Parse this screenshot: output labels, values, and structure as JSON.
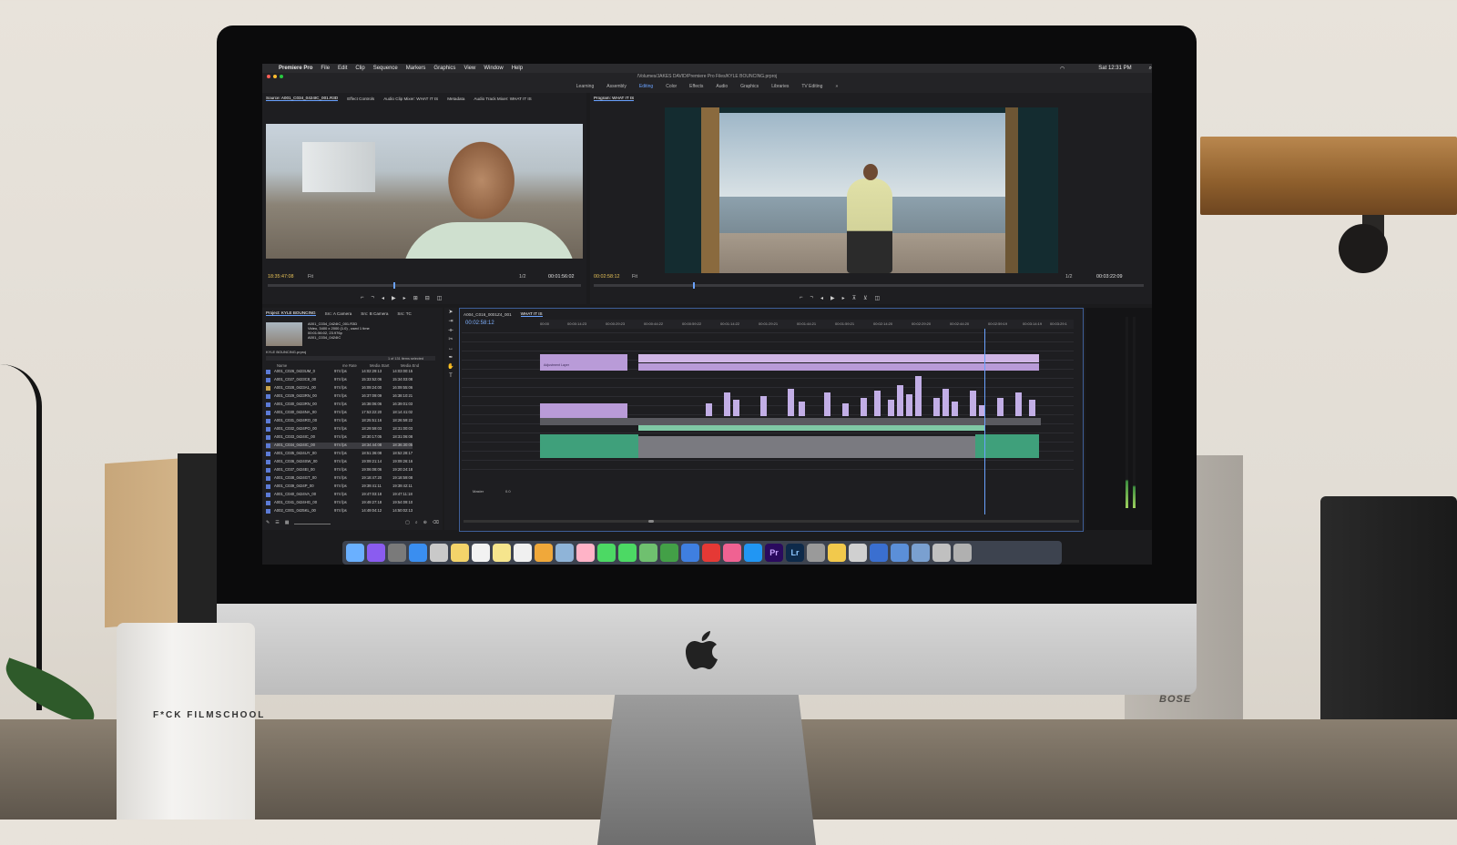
{
  "menubar": {
    "app": "Premiere Pro",
    "items": [
      "File",
      "Edit",
      "Clip",
      "Sequence",
      "Markers",
      "Graphics",
      "View",
      "Window",
      "Help"
    ],
    "clock": "Sat 12:31 PM"
  },
  "titlebar": {
    "path": "/Volumes/JAKES DAVID/Premiere Pro Files/KYLE BOUNCING.prproj"
  },
  "workspaces": {
    "items": [
      "Learning",
      "Assembly",
      "Editing",
      "Color",
      "Effects",
      "Audio",
      "Graphics",
      "Libraries",
      "TV Editing"
    ],
    "active": "Editing"
  },
  "source_panel": {
    "tabs": [
      "Source: A001_C034_0424IC_001.R3D",
      "Effect Controls",
      "Audio Clip Mixer: WHAT IT IS",
      "Metadata",
      "Audio Track Mixer: WHAT IT IS"
    ],
    "timecode": "18:35:47:08",
    "zoom": "Fit",
    "fraction": "1/2",
    "duration": "00:01:56:02"
  },
  "program_panel": {
    "tab": "Program: WHAT IT IS",
    "timecode": "00:02:58:12",
    "zoom": "Fit",
    "fraction": "1/2",
    "duration": "00:03:22:09"
  },
  "project_panel": {
    "tabs": [
      "Project: KYLE BOUNCING",
      "Src: A Camera",
      "Src: B Camera",
      "Src: TC"
    ],
    "preview_name": "A001_C034_0424IC_001.R3D",
    "preview_info": "Video, 3400 x 2000 (1.0)",
    "preview_uses": "used 1 time",
    "preview_tc": "00:01:56:02, 23.976p",
    "preview_audio": "A001_C034_0424IC",
    "bin": "KYLE BOUNCING.prproj",
    "selected_count": "1 of 131 items selected",
    "columns": [
      "Name",
      "me Rate",
      "Media Start",
      "Media End"
    ],
    "rows": [
      [
        "A001_C026_0423UM_0",
        "974 fps",
        "14:02:29:13",
        "14:03:00:15"
      ],
      [
        "A001_C027_0423C8_00",
        "974 fps",
        "15:33:52:06",
        "15:34:03:08"
      ],
      [
        "A001_C028_0423A1_00",
        "974 fps",
        "16:09:24:00",
        "16:09:55:06"
      ],
      [
        "A001_C029_0423RN_00",
        "974 fps",
        "16:37:09:09",
        "16:38:10:21"
      ],
      [
        "A001_C030_0423RN_00",
        "974 fps",
        "16:38:06:06",
        "16:39:01:03"
      ],
      [
        "A001_C030_0424NA_00",
        "974 fps",
        "17:53:22:20",
        "18:14:41:02"
      ],
      [
        "A001_C031_0424RO_00",
        "974 fps",
        "18:25:51:16",
        "18:26:59:22"
      ],
      [
        "A001_C032_0424PO_00",
        "974 fps",
        "18:29:59:03",
        "18:31:00:03"
      ],
      [
        "A001_C033_0424IC_00",
        "974 fps",
        "18:30:17:05",
        "18:31:06:08"
      ],
      [
        "A001_C034_0424IC_00",
        "974 fps",
        "18:34:44:08",
        "18:36:30:05"
      ],
      [
        "A001_C035_0424UY_00",
        "974 fps",
        "18:51:36:08",
        "18:52:28:17"
      ],
      [
        "A001_C036_0424SW_00",
        "974 fps",
        "19:09:21:14",
        "19:09:26:16"
      ],
      [
        "A001_C037_0424EI_00",
        "974 fps",
        "19:06:08:06",
        "19:20:24:18"
      ],
      [
        "A001_C038_0424GT_00",
        "974 fps",
        "19:18:47:20",
        "19:18:59:08"
      ],
      [
        "A001_C039_0424P_00",
        "974 fps",
        "19:39:41:11",
        "19:39:42:11"
      ],
      [
        "A001_C040_0424VA_00",
        "974 fps",
        "19:47:03:18",
        "19:47:11:18"
      ],
      [
        "A001_C041_0424HG_00",
        "974 fps",
        "19:49:27:18",
        "19:54:09:10"
      ],
      [
        "A002_C001_0425KL_00",
        "974 fps",
        "14:49:04:12",
        "14:50:02:13"
      ]
    ],
    "selected_row": 9
  },
  "timeline": {
    "tabs": [
      "A004_C016_0001Z4_001",
      "WHAT IT IS"
    ],
    "timecode": "00:02:58:12",
    "ruler": [
      "00:00",
      "00:00:14:23",
      "00:00:29:23",
      "00:00:44:22",
      "00:00:59:22",
      "00:01:14:22",
      "00:01:29:21",
      "00:01:44:21",
      "00:01:59:21",
      "00:02:14:20",
      "00:02:29:20",
      "00:02:44:20",
      "00:02:59:19",
      "00:03:14:19",
      "00:03:29:1"
    ],
    "master": "Master",
    "master_val": "0.0",
    "adjustment_label": "Adjustment Layer"
  },
  "dock": {
    "icons": [
      "finder-icon",
      "siri-icon",
      "launchpad-icon",
      "safari-icon",
      "photo-icon",
      "notes-icon",
      "calendar-icon",
      "stickies-icon",
      "textedit-icon",
      "pages-icon",
      "preview-icon",
      "photos-icon",
      "messages-icon",
      "facetime-icon",
      "maps-icon",
      "numbers-icon",
      "keynote-icon",
      "news-icon",
      "music-icon",
      "appstore-icon",
      "premiere-icon",
      "lightroom-icon",
      "prefs-icon",
      "finder2-icon",
      "screenshot-icon",
      "quicktime-icon",
      "quicktime2-icon",
      "folder-icon",
      "display-icon",
      "trash-icon"
    ],
    "premiere_label": "Pr",
    "lightroom_label": "Lr"
  },
  "room": {
    "mug_text": "F*CK FILMSCHOOL",
    "speaker_brand": "BOSE"
  },
  "colors": {
    "accent": "#6aa2ff",
    "timecode": "#e6c157",
    "clip_pink": "#b99bd8",
    "clip_green": "#3fa07b"
  }
}
